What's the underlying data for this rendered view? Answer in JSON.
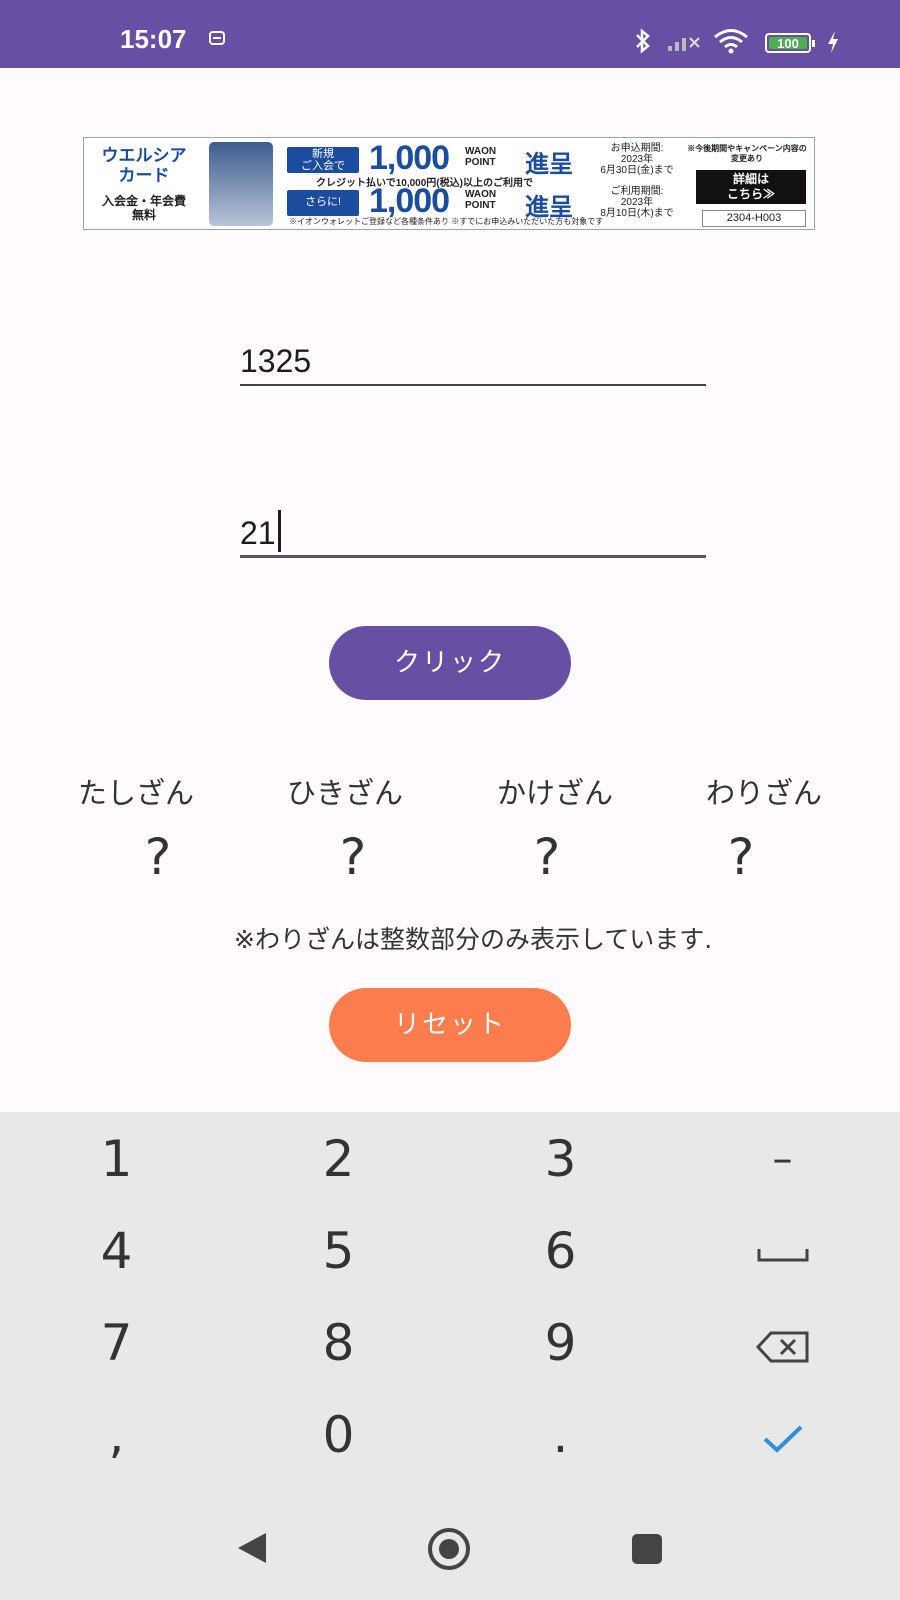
{
  "status_bar": {
    "time": "15:07",
    "battery": "100",
    "icons": [
      "bot-face-icon",
      "bluetooth-icon",
      "cell-signal-icon",
      "wifi-icon",
      "battery-icon",
      "charging-bolt-icon"
    ]
  },
  "ad": {
    "brand_line1": "ウエルシア",
    "brand_line2": "カード",
    "brand_sub1": "入会金・年会費",
    "brand_sub2": "無料",
    "row1_pill_1": "新規",
    "row1_pill_2": "ご入会で",
    "row1_amount": "1,000",
    "waon_1": "WAON",
    "waon_2": "POINT",
    "shin": "進呈",
    "row1_period_1": "お申込期間:",
    "row1_period_2": "2023年",
    "row1_period_3": "6月30日(金)まで",
    "middle": "クレジット払いで10,000円(税込)以上のご利用で",
    "row2_pill": "さらに!",
    "row2_amount": "1,000",
    "row2_period_1": "ご利用期間:",
    "row2_period_2": "2023年",
    "row2_period_3": "8月10日(木)まで",
    "foot": "※イオンウォレットご登録など各種条件あり ※すでにお申込みいただいた方も対象です",
    "note": "※今後期間やキャンペーン内容の変更あり",
    "detail_1": "詳細は",
    "detail_2": "こちら≫",
    "code": "2304-H003"
  },
  "inputs": {
    "first_value": "1325",
    "second_value": "21"
  },
  "buttons": {
    "click_label": "クリック",
    "reset_label": "リセット"
  },
  "operations": [
    {
      "label": "たしざん",
      "result": "?"
    },
    {
      "label": "ひきざん",
      "result": "?"
    },
    {
      "label": "かけざん",
      "result": "?"
    },
    {
      "label": "わりざん",
      "result": "?"
    }
  ],
  "note": "※わりざんは整数部分のみ表示しています.",
  "keyboard": {
    "keys": [
      "1",
      "2",
      "3",
      "−",
      "4",
      "5",
      "6",
      "space",
      "7",
      "8",
      "9",
      "backspace",
      ",",
      "0",
      ".",
      "enter"
    ],
    "labels": {
      "k1": "1",
      "k2": "2",
      "k3": "3",
      "minus": "–",
      "k4": "4",
      "k5": "5",
      "k6": "6",
      "k7": "7",
      "k8": "8",
      "k9": "9",
      "comma": ",",
      "k0": "0",
      "period": "."
    },
    "accent_color": "#2f8fd8"
  },
  "nav": [
    "back-icon",
    "home-icon",
    "recents-icon"
  ],
  "colors": {
    "primary": "#6750a4",
    "reset": "#fb7c4c",
    "status_bar": "#6750a4",
    "battery": "#4caf50"
  }
}
